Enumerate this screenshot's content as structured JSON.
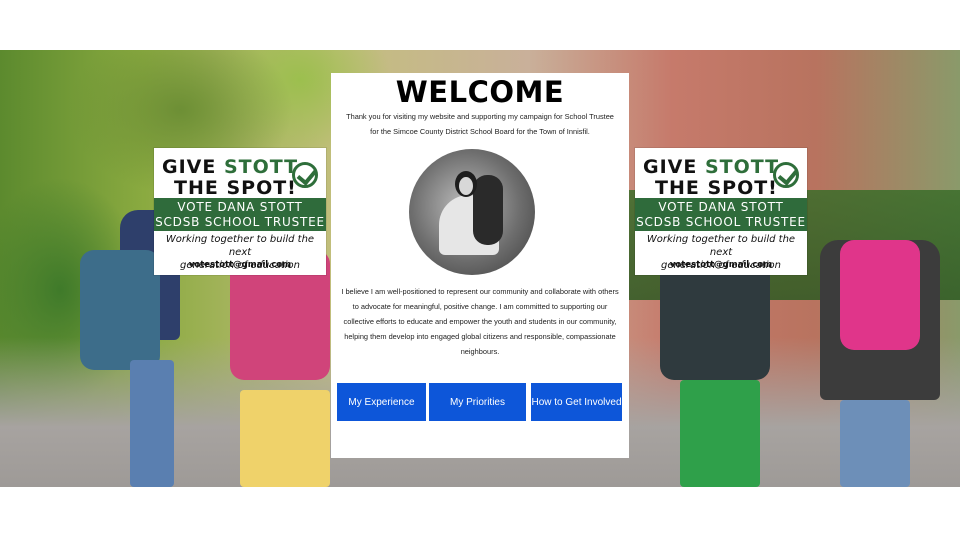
{
  "signs": {
    "line1_give": "GIVE ",
    "line1_stott": "STOTT",
    "line2": "THE SPOT!",
    "band_line1": "VOTE DANA STOTT",
    "band_line2": "SCDSB SCHOOL TRUSTEE",
    "tagline_line1": "Working together to build the next",
    "tagline_line2": "generation of education",
    "email": "votestott@gmail.com",
    "accent_color": "#2f6b3b",
    "icon": "checkmark-circle-icon"
  },
  "welcome": {
    "title": "WELCOME",
    "intro": "Thank you for visiting my website and supporting my campaign for School Trustee for the Simcoe County District School Board for the Town of Innisfil.",
    "body": "I believe I am well-positioned to represent our community and collaborate with others to advocate for meaningful, positive change. I am committed to supporting our collective efforts to educate and empower the youth and students in our community, helping them develop into engaged global citizens and responsible, compassionate neighbours."
  },
  "nav_buttons": {
    "experience": "My Experience",
    "priorities": "My Priorities",
    "get_involved": "How to Get Involved",
    "color": "#0d56d9"
  }
}
